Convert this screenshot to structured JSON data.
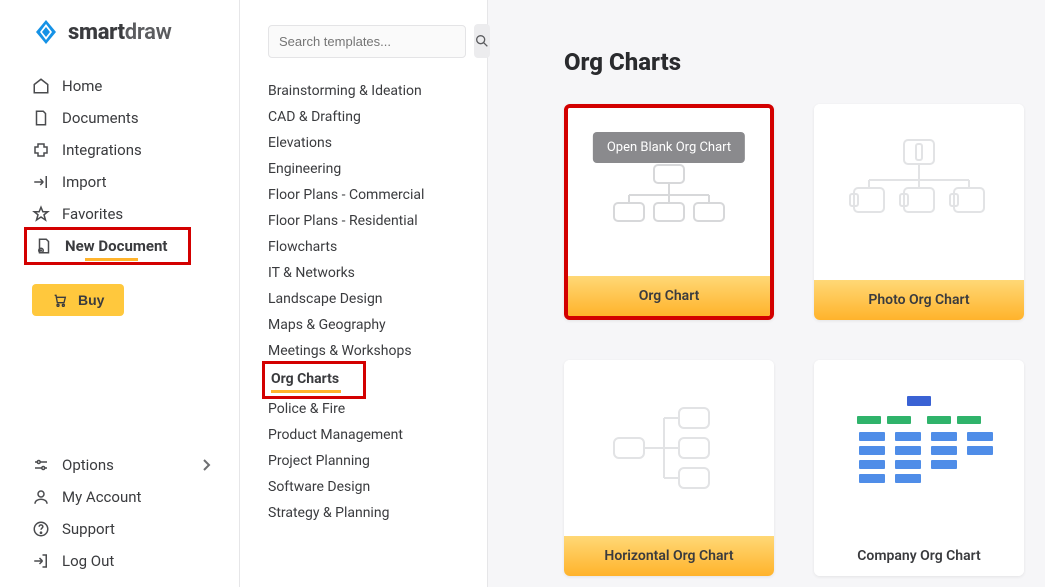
{
  "logo": {
    "brand_prefix": "smart",
    "brand_suffix": "draw"
  },
  "sidebar": {
    "items": [
      {
        "label": "Home"
      },
      {
        "label": "Documents"
      },
      {
        "label": "Integrations"
      },
      {
        "label": "Import"
      },
      {
        "label": "Favorites"
      },
      {
        "label": "New Document"
      }
    ],
    "buy_label": "Buy",
    "bottom": [
      {
        "label": "Options"
      },
      {
        "label": "My Account"
      },
      {
        "label": "Support"
      },
      {
        "label": "Log Out"
      }
    ]
  },
  "search": {
    "placeholder": "Search templates..."
  },
  "categories": [
    "Brainstorming & Ideation",
    "CAD & Drafting",
    "Elevations",
    "Engineering",
    "Floor Plans - Commercial",
    "Floor Plans - Residential",
    "Flowcharts",
    "IT & Networks",
    "Landscape Design",
    "Maps & Geography",
    "Meetings & Workshops",
    "Org Charts",
    "Police & Fire",
    "Product Management",
    "Project Planning",
    "Software Design",
    "Strategy & Planning"
  ],
  "categories_selected_index": 11,
  "main": {
    "heading": "Org Charts",
    "open_blank_label": "Open Blank Org Chart",
    "cards": [
      {
        "label": "Org Chart"
      },
      {
        "label": "Photo Org Chart"
      },
      {
        "label": "Horizontal Org Chart"
      },
      {
        "label": "Company Org Chart"
      }
    ]
  }
}
